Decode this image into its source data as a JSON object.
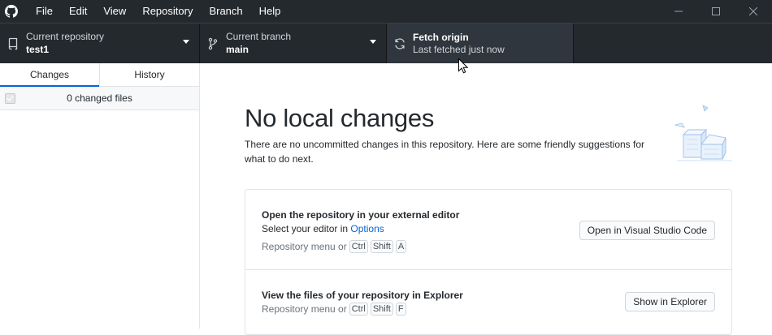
{
  "titlebar": {
    "menu": [
      "File",
      "Edit",
      "View",
      "Repository",
      "Branch",
      "Help"
    ],
    "icons": {
      "logo": "github-icon",
      "minimize": "minimize-icon",
      "maximize": "maximize-icon",
      "close": "close-icon"
    }
  },
  "toolbar": {
    "repo": {
      "label": "Current repository",
      "value": "test1"
    },
    "branch": {
      "label": "Current branch",
      "value": "main"
    },
    "fetch": {
      "title": "Fetch origin",
      "status": "Last fetched just now"
    }
  },
  "sidebar": {
    "tabs": [
      "Changes",
      "History"
    ],
    "active_tab": "Changes",
    "changed_files": "0 changed files"
  },
  "main": {
    "heading": "No local changes",
    "description": "There are no uncommitted changes in this repository. Here are some friendly suggestions for what to do next.",
    "card1": {
      "title": "Open the repository in your external editor",
      "sub_prefix": "Select your editor in ",
      "sub_link": "Options",
      "shortcut_prefix": "Repository menu or",
      "keys": [
        "Ctrl",
        "Shift",
        "A"
      ],
      "button": "Open in Visual Studio Code"
    },
    "card2": {
      "title": "View the files of your repository in Explorer",
      "shortcut_prefix": "Repository menu or",
      "keys": [
        "Ctrl",
        "Shift",
        "F"
      ],
      "button": "Show in Explorer"
    }
  },
  "colors": {
    "titlebar_bg": "#24292e",
    "accent": "#0366d6",
    "fetch_bg": "#2f363d"
  }
}
